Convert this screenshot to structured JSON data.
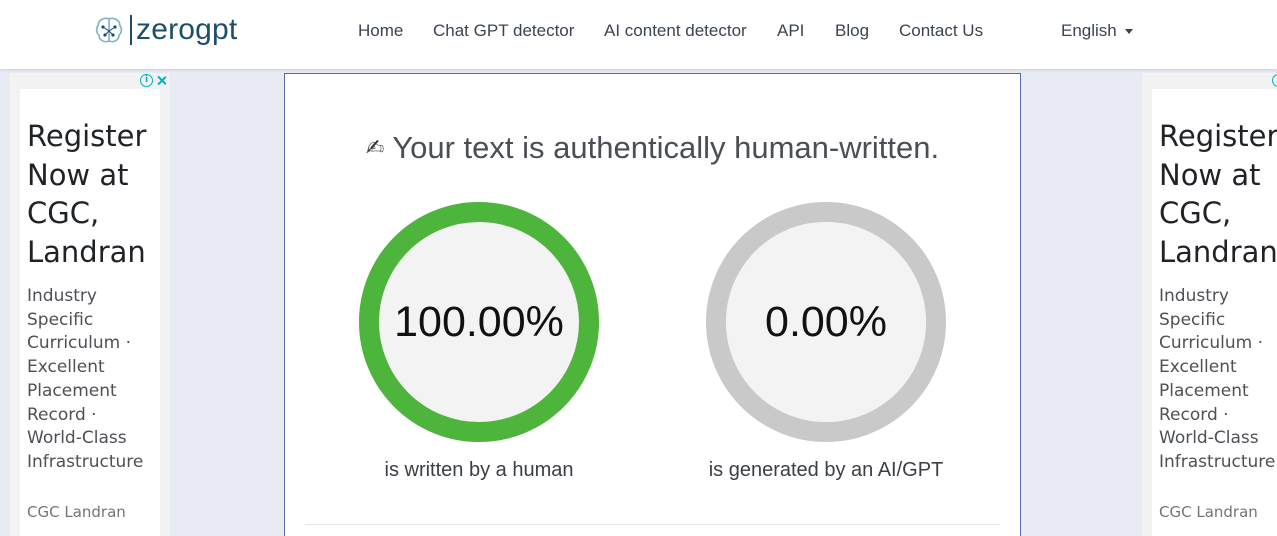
{
  "brand": {
    "name": "zerogpt",
    "primary_color": "#1d4e6e"
  },
  "nav": {
    "items": [
      {
        "label": "Home"
      },
      {
        "label": "Chat GPT detector"
      },
      {
        "label": "AI content detector"
      },
      {
        "label": "API"
      },
      {
        "label": "Blog"
      },
      {
        "label": "Contact Us"
      }
    ],
    "language": {
      "selected": "English"
    }
  },
  "ads": {
    "left": {
      "title": "Register Now at CGC, Landran",
      "body": "Industry Specific Curriculum · Excellent Placement Record · World-Class Infrastructure",
      "advertiser": "CGC Landran",
      "info_icon": "info-icon",
      "close_icon": "close-icon"
    },
    "right": {
      "title": "Register Now at CGC, Landran",
      "body": "Industry Specific Curriculum · Excellent Placement Record · World-Class Infrastructure",
      "advertiser": "CGC Landran",
      "info_icon": "info-icon"
    }
  },
  "result": {
    "icon": "writing-hand-icon",
    "icon_glyph": "✍",
    "headline": "Your text is authentically human-written.",
    "human": {
      "value_text": "100.00%",
      "fraction": 1.0,
      "caption": "is written by a human",
      "color": "#4db53c"
    },
    "ai": {
      "value_text": "0.00%",
      "fraction": 0.0,
      "caption": "is generated by an AI/GPT",
      "color": "#ff4d4d"
    },
    "track_color": "#c9c9c9",
    "inner_color": "#f3f3f3"
  }
}
